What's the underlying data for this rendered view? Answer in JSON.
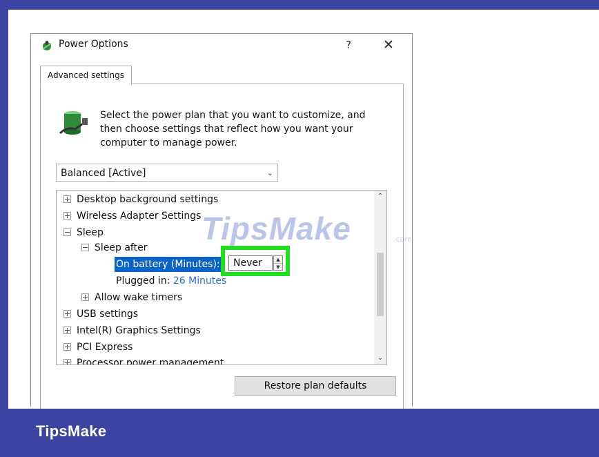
{
  "dialog": {
    "title": "Power Options",
    "help_label": "?",
    "close_label": "✕",
    "tab_label": "Advanced settings",
    "intro_text": "Select the power plan that you want to customize, and then choose settings that reflect how you want your computer to manage power.",
    "plan_select": {
      "value": "Balanced [Active]"
    },
    "tree": {
      "desktop_background": "Desktop background settings",
      "wireless_adapter": "Wireless Adapter Settings",
      "sleep": "Sleep",
      "sleep_after": "Sleep after",
      "on_battery_label": "On battery (Minutes):",
      "on_battery_value": "Never",
      "plugged_in_label": "Plugged in:",
      "plugged_in_value": "26 Minutes",
      "allow_wake_timers": "Allow wake timers",
      "usb_settings": "USB settings",
      "intel_graphics": "Intel(R) Graphics Settings",
      "pci_express": "PCI Express",
      "processor_power": "Processor power management"
    },
    "restore_button": "Restore plan defaults"
  },
  "watermark": {
    "text": "TipsMake",
    "suffix": ".com"
  },
  "footer": {
    "brand": "TipsMake"
  },
  "colors": {
    "brand_band": "#3b44a0",
    "selection": "#0a64c8",
    "highlight": "#22dd22",
    "value_link": "#2f6fc8"
  },
  "icons": {
    "title": "power-plan-icon",
    "intro": "battery-plug-icon"
  }
}
